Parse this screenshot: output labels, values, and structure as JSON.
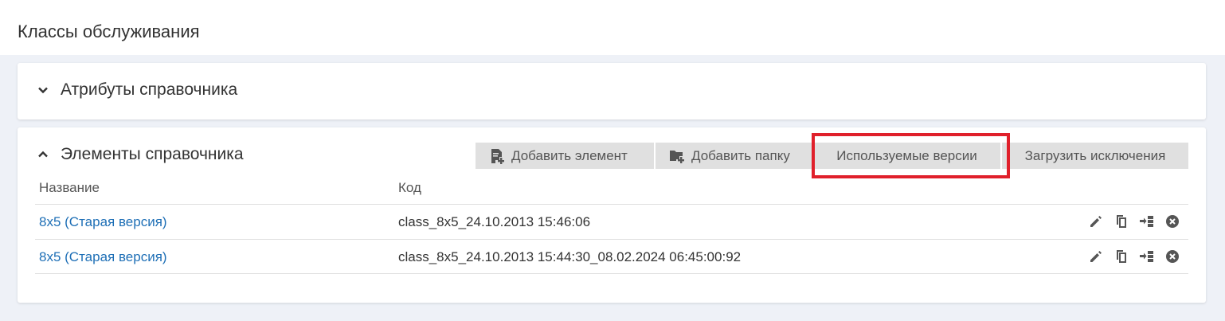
{
  "page": {
    "title": "Классы обслуживания"
  },
  "attributes_panel": {
    "title": "Атрибуты справочника",
    "expanded": false
  },
  "elements_panel": {
    "title": "Элементы справочника",
    "expanded": true,
    "toolbar": {
      "add_element": {
        "label": "Добавить элемент",
        "icon": "add-document-icon"
      },
      "add_folder": {
        "label": "Добавить папку",
        "icon": "add-folder-icon"
      },
      "used_versions": {
        "label": "Используемые версии",
        "highlighted": true
      },
      "load_exceptions": {
        "label": "Загрузить исключения"
      }
    },
    "columns": {
      "name": "Название",
      "code": "Код"
    },
    "rows": [
      {
        "name": "8x5 (Старая версия)",
        "code": "class_8x5_24.10.2013 15:46:06"
      },
      {
        "name": "8x5 (Старая версия)",
        "code": "class_8x5_24.10.2013 15:44:30_08.02.2024 06:45:00:92"
      }
    ],
    "row_actions": [
      "edit-icon",
      "copy-icon",
      "move-icon",
      "delete-icon"
    ]
  },
  "colors": {
    "background": "#eef1f7",
    "link": "#1e6fb6",
    "button_bg": "#e0e0e0",
    "highlight": "#e0202b"
  }
}
